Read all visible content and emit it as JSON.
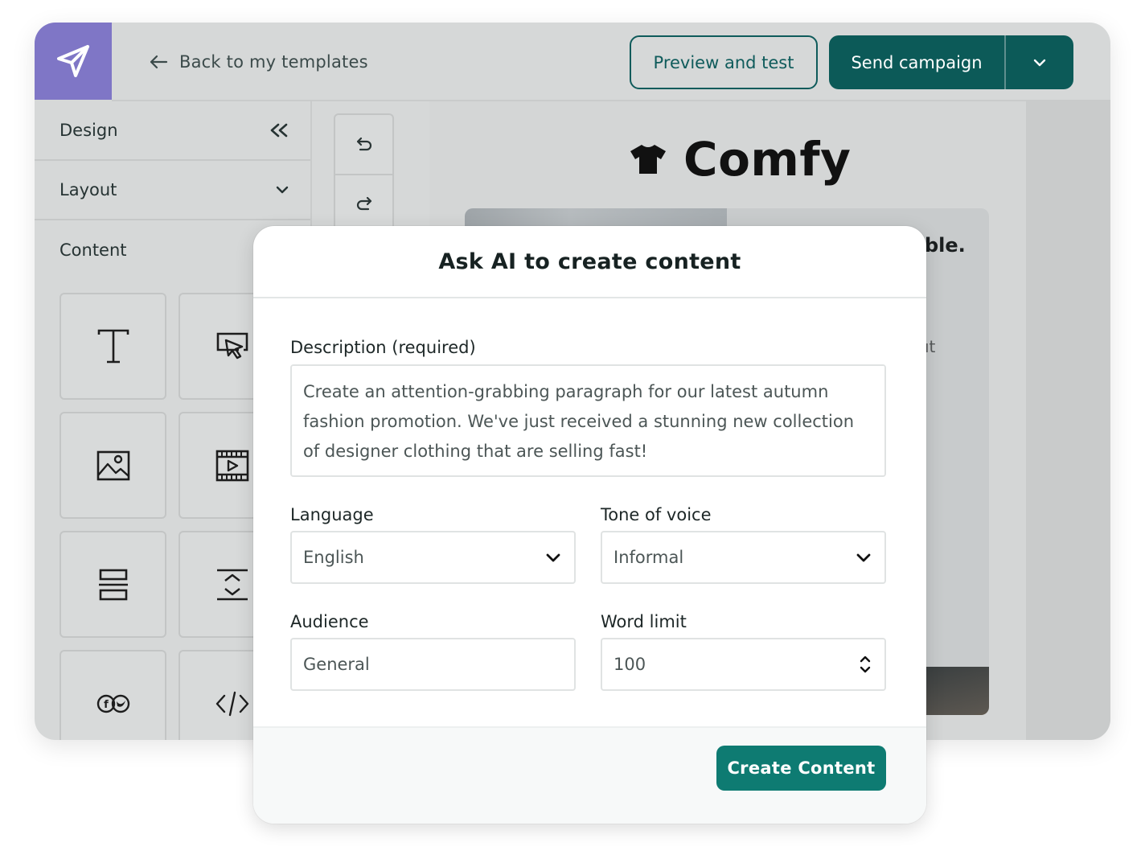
{
  "header": {
    "back_label": "Back to my templates",
    "preview_label": "Preview and test",
    "send_label": "Send campaign"
  },
  "sidebar": {
    "design_label": "Design",
    "layout_label": "Layout",
    "content_label": "Content",
    "blocks": [
      "text-block-icon",
      "button-block-icon",
      "image-block-icon",
      "video-block-icon",
      "divider-block-icon",
      "spacer-block-icon",
      "social-block-icon",
      "html-block-icon"
    ]
  },
  "canvas": {
    "brand_name": "Comfy",
    "heading_fragment": "ble.",
    "text_fragment": "ıt"
  },
  "modal": {
    "title": "Ask AI to create content",
    "description_label": "Description (required)",
    "description_value": "Create an attention-grabbing paragraph for our latest autumn fashion promotion. We've just received a stunning new collection of designer clothing that are selling fast!",
    "language_label": "Language",
    "language_value": "English",
    "tone_label": "Tone of voice",
    "tone_value": "Informal",
    "audience_label": "Audience",
    "audience_value": "General",
    "word_limit_label": "Word limit",
    "word_limit_value": "100",
    "create_label": "Create Content"
  },
  "colors": {
    "brand_purple": "#7f76c6",
    "primary_teal": "#0c5a58",
    "create_teal": "#0e7b72"
  }
}
